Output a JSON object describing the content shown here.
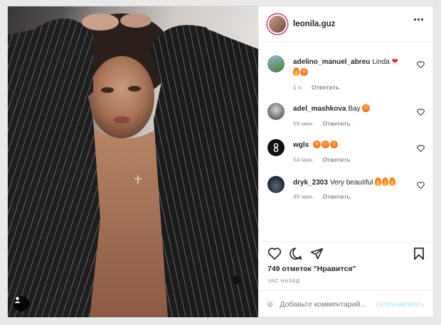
{
  "post": {
    "author": "leonila.guz",
    "likes_text": "749 отметок \"Нравится\"",
    "time_text": "ЧАС НАЗАД"
  },
  "comments": [
    {
      "user": "adelino_manuel_abreu",
      "text": "Linda",
      "emoji": [
        "red-heart",
        "fire",
        "heart-eyes"
      ],
      "time": "1 ч.",
      "reply": "Ответить"
    },
    {
      "user": "adel_mashkova",
      "text": "Вау",
      "emoji": [
        "heart-eyes"
      ],
      "time": "59 мин.",
      "reply": "Ответить"
    },
    {
      "user": "wgls",
      "text": "",
      "emoji": [
        "heart-eyes",
        "heart-eyes",
        "heart-eyes"
      ],
      "time": "54 мин.",
      "reply": "Ответить"
    },
    {
      "user": "dryk_2303",
      "text": "Very beautiful",
      "emoji": [
        "fire",
        "fire",
        "fire"
      ],
      "time": "49 мин.",
      "reply": "Ответить"
    }
  ],
  "composer": {
    "placeholder": "Добавьте комментарий...",
    "post_label": "Опубликовать"
  },
  "colors": {
    "link_disabled": "#b2dffc",
    "story_ring": "#d3267a",
    "meta_gray": "#8e8e8e"
  }
}
